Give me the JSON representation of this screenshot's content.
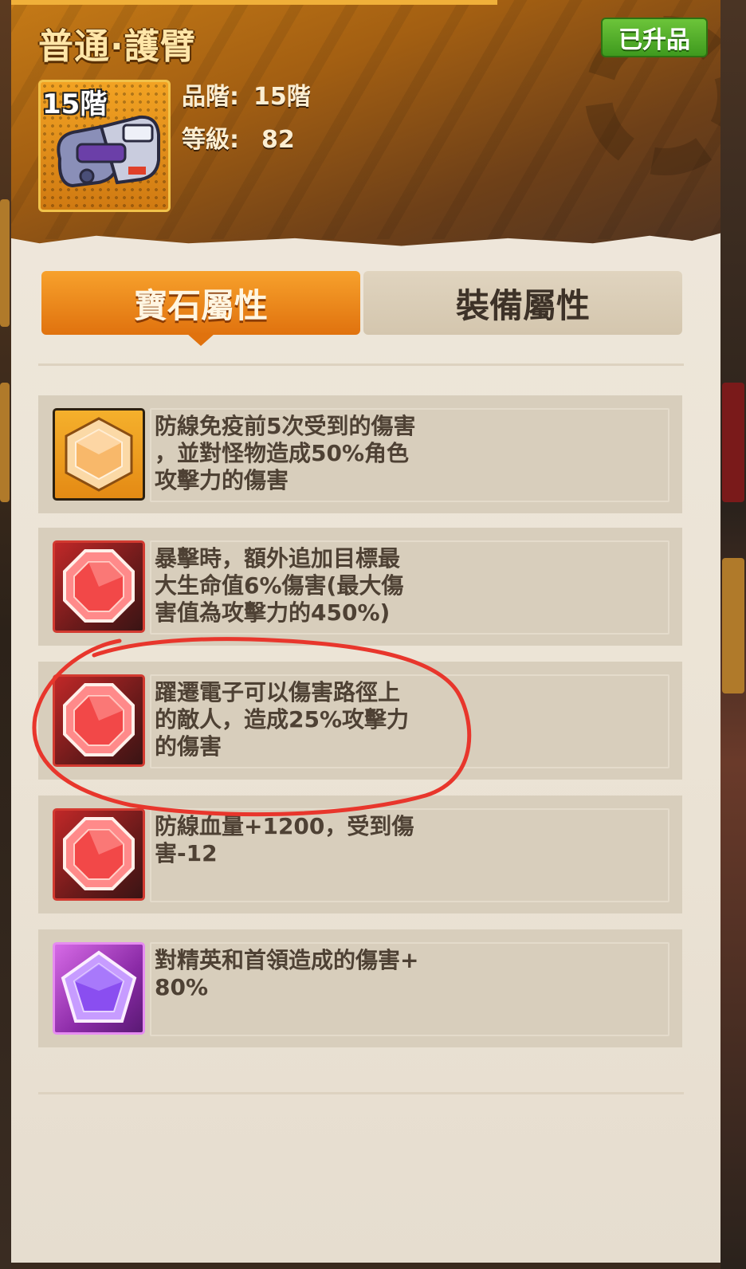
{
  "header": {
    "title": "普通·護臂",
    "upgraded_badge": "已升品",
    "tier_badge": "15階",
    "grade_label": "品階:",
    "grade_value": "15階",
    "level_label": "等級:",
    "level_value": "82"
  },
  "tabs": [
    {
      "label": "寶石屬性",
      "active": true
    },
    {
      "label": "裝備屬性",
      "active": false
    }
  ],
  "gems": [
    {
      "color": "orange",
      "icon": "hexagon-gem-icon",
      "text": "防線免疫前5次受到的傷害\n，並對怪物造成50%角色\n攻擊力的傷害"
    },
    {
      "color": "red",
      "icon": "octagon-gem-icon",
      "text": "暴擊時，額外追加目標最\n大生命值6%傷害(最大傷\n害值為攻擊力的450%)"
    },
    {
      "color": "red",
      "icon": "octagon-gem-icon",
      "text": "躍遷電子可以傷害路徑上\n的敵人，造成25%攻擊力\n的傷害"
    },
    {
      "color": "red",
      "icon": "octagon-gem-icon",
      "text": "防線血量+1200，受到傷\n害-12"
    },
    {
      "color": "purple",
      "icon": "pentagon-gem-icon",
      "text": "對精英和首領造成的傷害+\n80%"
    }
  ],
  "colors": {
    "active_tab": "#f08a1c",
    "upgraded_badge": "#4aa424",
    "annotation_circle": "#e8362c"
  }
}
